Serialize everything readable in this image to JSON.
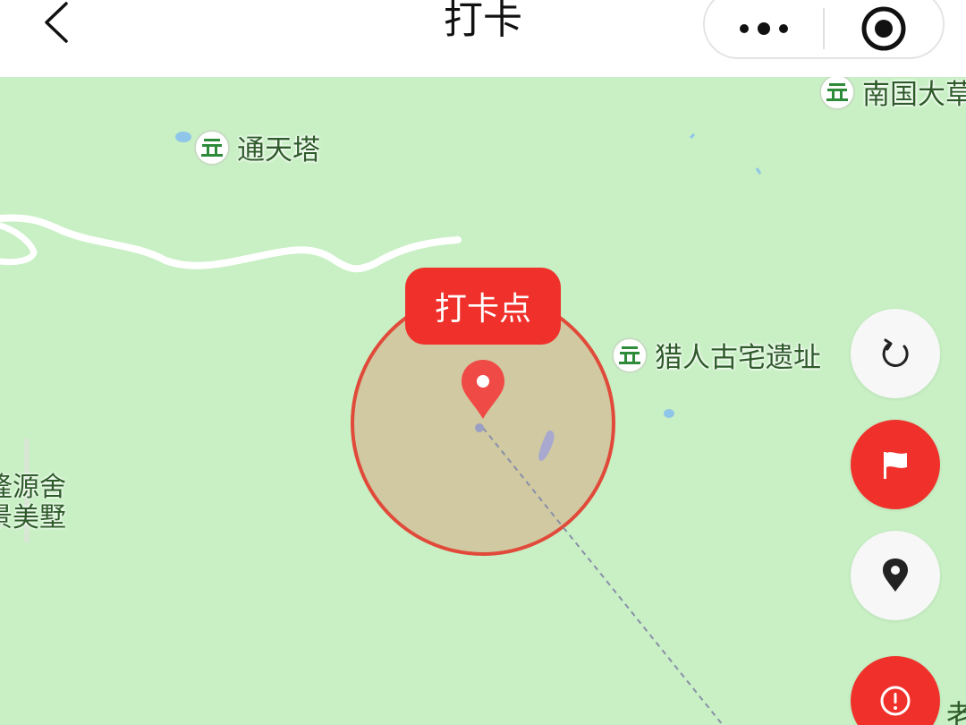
{
  "header": {
    "title": "打卡",
    "back_icon": "chevron-left-icon",
    "more_icon": "more-dots-icon",
    "close_icon": "target-circle-icon"
  },
  "map": {
    "pois": [
      {
        "name": "南国大草",
        "icon": "scenic-spot-icon"
      },
      {
        "name": "通天塔",
        "icon": "scenic-spot-icon"
      },
      {
        "name": "猎人古宅遗址",
        "icon": "scenic-spot-icon"
      }
    ],
    "area_labels": [
      {
        "line1": "隆源舍",
        "line2": "景美墅"
      }
    ],
    "checkin_tag": "打卡点",
    "colors": {
      "map_background": "#c8f0c4",
      "accent_red": "#f0312b",
      "circle_fill": "#d0c9a1",
      "circle_stroke": "#e14a3a"
    }
  },
  "side_buttons": [
    {
      "icon": "refresh-icon",
      "style": "white"
    },
    {
      "icon": "flag-icon",
      "style": "red"
    },
    {
      "icon": "location-pin-icon",
      "style": "white"
    },
    {
      "icon": "alert-icon",
      "style": "red",
      "side_label": "老"
    }
  ]
}
